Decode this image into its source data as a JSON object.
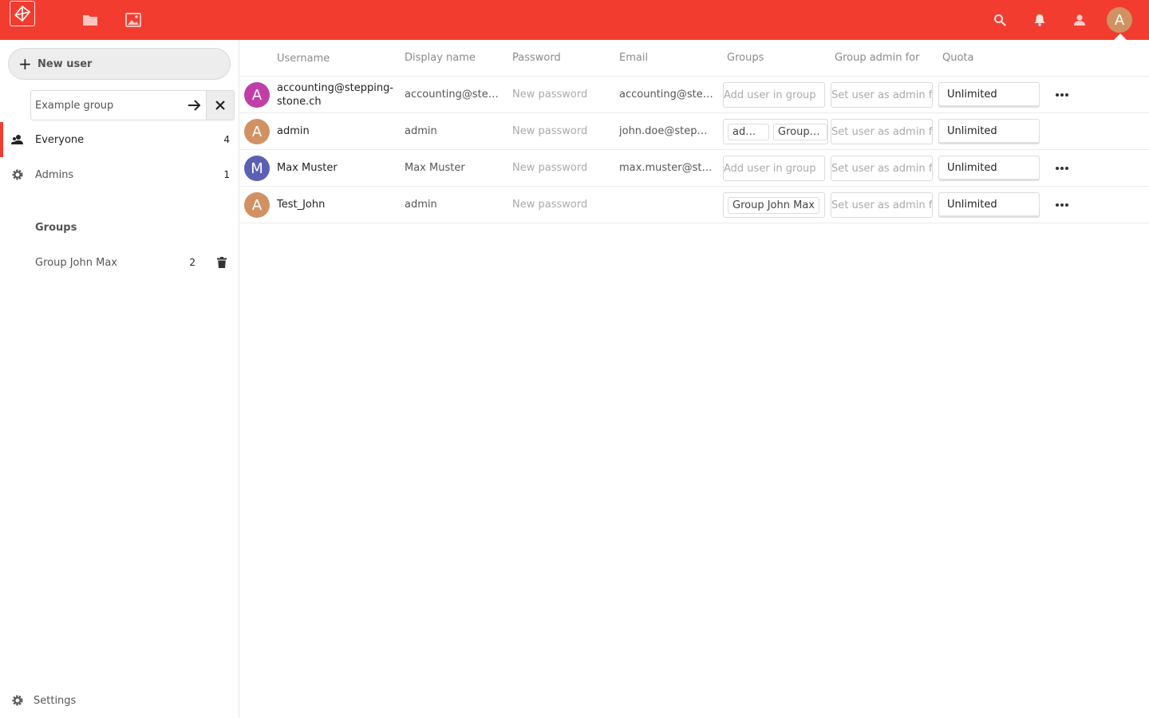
{
  "header": {
    "icons": [
      "logo-icon",
      "files-icon",
      "gallery-icon",
      "search-icon",
      "notifications-icon",
      "contacts-icon"
    ],
    "avatar_letter": "A",
    "accent": "#f23c30"
  },
  "sidebar": {
    "new_user_label": "New user",
    "group_input_placeholder": "Example group",
    "items": [
      {
        "label": "Everyone",
        "count": "4"
      },
      {
        "label": "Admins",
        "count": "1"
      }
    ],
    "groups_caption": "Groups",
    "groups": [
      {
        "label": "Group John Max",
        "count": "2"
      }
    ],
    "settings_label": "Settings"
  },
  "table": {
    "headers": [
      "Username",
      "Display name",
      "Password",
      "Email",
      "Groups",
      "Group admin for",
      "Quota"
    ],
    "rows": [
      {
        "avatar": "A",
        "avatar_color": "#c03fa6",
        "username": "accounting@stepping-stone.ch",
        "display_name": "accounting@stepping-stone.ch",
        "password_placeholder": "New password",
        "email": "accounting@stepping-stone.ch",
        "groups_placeholder": "Add user in group",
        "groups": [],
        "admin_placeholder": "Set user as admin for",
        "quota": "Unlimited",
        "has_more": true
      },
      {
        "avatar": "A",
        "avatar_color": "#d09262",
        "username": "admin",
        "display_name": "admin",
        "password_placeholder": "New password",
        "email": "john.doe@stepping-stone.ch",
        "groups_placeholder": "",
        "groups": [
          "admin",
          "Group John Max"
        ],
        "admin_placeholder": "Set user as admin for",
        "quota": "Unlimited",
        "has_more": false
      },
      {
        "avatar": "M",
        "avatar_color": "#5b60b5",
        "username": "Max Muster",
        "display_name": "Max Muster",
        "password_placeholder": "New password",
        "email": "max.muster@stepping-stone.ch",
        "groups_placeholder": "Add user in group",
        "groups": [],
        "admin_placeholder": "Set user as admin for",
        "quota": "Unlimited",
        "has_more": true
      },
      {
        "avatar": "A",
        "avatar_color": "#d09262",
        "username": "Test_John",
        "display_name": "admin",
        "password_placeholder": "New password",
        "email": "",
        "groups_placeholder": "",
        "groups": [
          "Group John Max"
        ],
        "admin_placeholder": "Set user as admin for",
        "quota": "Unlimited",
        "has_more": true
      }
    ]
  }
}
